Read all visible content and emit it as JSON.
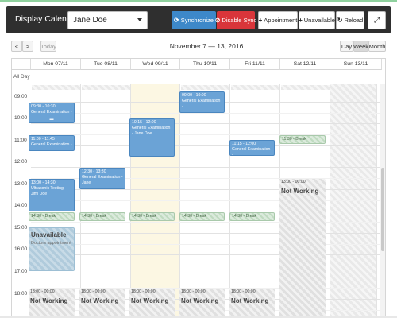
{
  "toolbar": {
    "title": "Display Calendar",
    "person": "Jane Doe",
    "sync": "Synchronize",
    "disable_sync": "Disable Sync",
    "appointment": "Appointment",
    "unavailable": "Unavailable",
    "reload": "Reload",
    "icons": {
      "sync": "sync-icon",
      "disable": "disable-icon",
      "appointment": "plus-icon",
      "unavailable": "plus-icon",
      "reload": "reload-icon",
      "fullscreen": "fullscreen-icon"
    }
  },
  "nav": {
    "prev": "<",
    "next": ">",
    "today": "Today",
    "range": "November 7 — 13, 2016",
    "views": [
      "Day",
      "Week",
      "Month"
    ],
    "active_view": "Week"
  },
  "calendar": {
    "allday_label": "All Day",
    "days": [
      "Mon 07/11",
      "Tue 08/11",
      "Wed 09/11",
      "Thu 10/11",
      "Fri 11/11",
      "Sat 12/11",
      "Sun 13/11"
    ],
    "hours": [
      "09:00",
      "10:00",
      "11:00",
      "12:00",
      "13:00",
      "14:00",
      "15:00",
      "16:00",
      "17:00",
      "18:00"
    ],
    "events": {
      "mon1": {
        "time": "09:30 - 10:30",
        "title": "General Examination -"
      },
      "mon2": {
        "time": "11:00 - 11:45",
        "title": "General Examination -"
      },
      "mon3": {
        "time": "13:00 - 14:30",
        "title": "Ultrasonic Testing - Jimi Doe"
      },
      "mon_break": {
        "time": "14:30 - Break"
      },
      "mon_unav": {
        "title": "Unavailable",
        "note": "Doctors appointment"
      },
      "mon_nw": {
        "time": "18:00 - 00:00",
        "title": "Not Working"
      },
      "tue1": {
        "time": "12:30 - 13:30",
        "title": "General Examination - Jane"
      },
      "tue_break": {
        "time": "14:30 - Break"
      },
      "tue_nw": {
        "time": "18:00 - 00:00",
        "title": "Not Working"
      },
      "wed1": {
        "time": "10:15 - 12:00",
        "title": "General Examination - Jane Doe"
      },
      "wed_break": {
        "time": "14:30 - Break"
      },
      "wed_nw": {
        "time": "18:00 - 00:00",
        "title": "Not Working"
      },
      "thu1": {
        "time": "09:00 - 10:00",
        "title": "General Examination -"
      },
      "thu_break": {
        "time": "14:30 - Break"
      },
      "thu_nw": {
        "time": "18:00 - 00:00",
        "title": "Not Working"
      },
      "fri1": {
        "time": "11:15 - 12:00",
        "title": "General Examination -"
      },
      "fri_break": {
        "time": "14:30 - Break"
      },
      "fri_nw": {
        "time": "18:00 - 00:00",
        "title": "Not Working"
      },
      "sat_break": {
        "time": "11:30 - Break"
      },
      "sat_nw": {
        "time": "13:00 - 00:00",
        "title": "Not Working"
      }
    }
  },
  "colors": {
    "sync": "#3d88c9",
    "disable": "#d9353a",
    "event": "#6ba3d6",
    "today": "#fcf7e3",
    "toolbar": "#2f2f2f"
  }
}
